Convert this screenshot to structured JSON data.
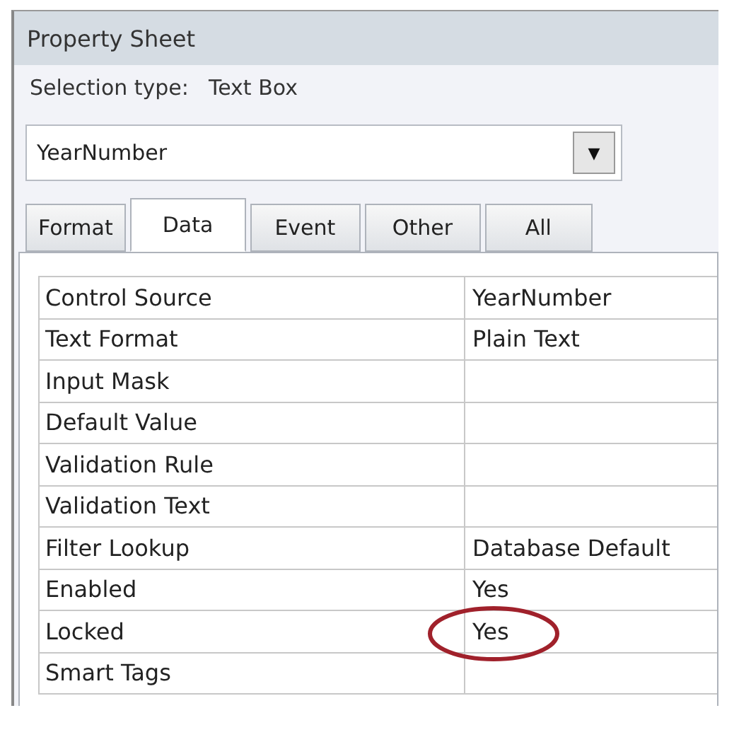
{
  "window": {
    "title": "Property Sheet"
  },
  "selection_type": {
    "label": "Selection type:",
    "value": "Text Box"
  },
  "object_selector": {
    "value": "YearNumber",
    "arrow": "▼"
  },
  "tabs": [
    {
      "label": "Format",
      "selected": false
    },
    {
      "label": "Data",
      "selected": true
    },
    {
      "label": "Event",
      "selected": false
    },
    {
      "label": "Other",
      "selected": false
    },
    {
      "label": "All",
      "selected": false
    }
  ],
  "properties": [
    {
      "name": "Control Source",
      "value": "YearNumber",
      "circled": false
    },
    {
      "name": "Text Format",
      "value": "Plain Text",
      "circled": false
    },
    {
      "name": "Input Mask",
      "circled": false
    },
    {
      "name": "Default Value",
      "circled": false
    },
    {
      "name": "Validation Rule",
      "circled": false
    },
    {
      "name": "Validation Text",
      "circled": false
    },
    {
      "name": "Filter Lookup",
      "value": "Database Default",
      "circled": false
    },
    {
      "name": "Enabled",
      "value": "Yes",
      "circled": false
    },
    {
      "name": "Locked",
      "value": "Yes",
      "circled": true
    },
    {
      "name": "Smart Tags",
      "circled": false
    }
  ]
}
